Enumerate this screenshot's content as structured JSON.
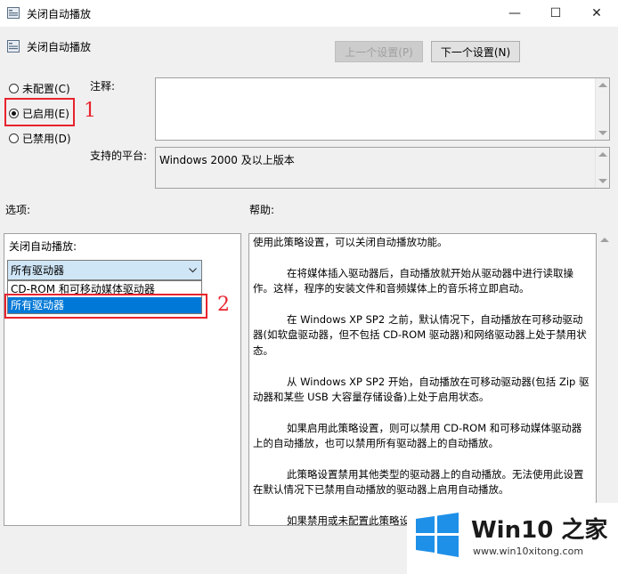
{
  "window": {
    "title": "关闭自动播放",
    "controls": {
      "minimize": "—",
      "maximize": "☐",
      "close": "✕"
    }
  },
  "header": {
    "policy_name": "关闭自动播放",
    "prev_button": "上一个设置(P)",
    "next_button": "下一个设置(N)"
  },
  "radios": {
    "not_configured": "未配置(C)",
    "enabled": "已启用(E)",
    "disabled": "已禁用(D)",
    "selected": "enabled"
  },
  "annotations": {
    "marker1": "1",
    "marker2": "2"
  },
  "comment": {
    "label": "注释:",
    "value": ""
  },
  "platform": {
    "label": "支持的平台:",
    "value": "Windows 2000 及以上版本"
  },
  "sections": {
    "options": "选项:",
    "help": "帮助:"
  },
  "options": {
    "field_label": "关闭自动播放:",
    "selected_value": "所有驱动器",
    "dropdown_items": [
      "CD-ROM 和可移动媒体驱动器",
      "所有驱动器"
    ],
    "highlighted_index": 1
  },
  "help": {
    "paragraphs": [
      "使用此策略设置，可以关闭自动播放功能。",
      "在将媒体插入驱动器后，自动播放就开始从驱动器中进行读取操作。这样，程序的安装文件和音频媒体上的音乐将立即启动。",
      "在 Windows XP SP2 之前，默认情况下，自动播放在可移动驱动器(如软盘驱动器，但不包括 CD-ROM 驱动器)和网络驱动器上处于禁用状态。",
      "从 Windows XP SP2 开始，自动播放在可移动驱动器(包括 Zip 驱动器和某些 USB 大容量存储设备)上处于启用状态。",
      "如果启用此策略设置，则可以禁用 CD-ROM 和可移动媒体驱动器上的自动播放，也可以禁用所有驱动器上的自动播放。",
      "此策略设置禁用其他类型的驱动器上的自动播放。无法使用此设置在默认情况下已禁用自动播放的驱动器上启用自动播放。",
      "如果禁用或未配置此策略设"
    ]
  },
  "watermark": {
    "title": "Win10 之家",
    "url": "www.win10xitong.com",
    "colors": {
      "logo": "#1e90e8"
    }
  },
  "colors": {
    "annotation_red": "#e8232d",
    "selection_blue": "#0078d7"
  }
}
